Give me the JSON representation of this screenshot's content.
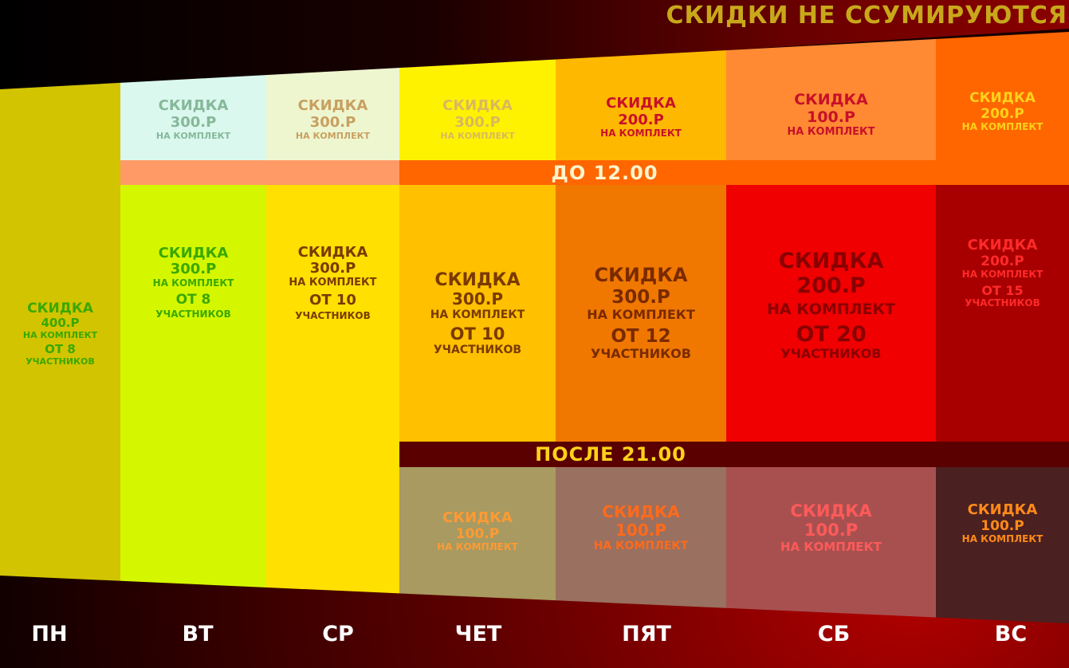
{
  "title": {
    "text": "СКИДКИ НЕ ССУМИРУЮТСЯ",
    "color": "#c8a81a"
  },
  "bands": {
    "morning": {
      "label": "ДО 12.00",
      "color": "#fff4cc",
      "bg_left": "#ff9a66",
      "bg_right": "#ff6600"
    },
    "evening": {
      "label": "ПОСЛЕ 21.00",
      "color": "#ffd21a",
      "bg": "#5a0000"
    }
  },
  "monday": {
    "title": "СКИДКА",
    "amount": "400.Р",
    "unit": "НА КОМПЛЕКТ",
    "from": "ОТ 8",
    "participants": "УЧАСТНИКОВ",
    "bg": "#d2c400",
    "color": "#3aa800"
  },
  "morning": [
    {
      "day": "ВТ",
      "title": "СКИДКА",
      "amount": "300.Р",
      "unit": "НА КОМПЛЕКТ",
      "bg": "#daf8ee",
      "color": "#86b89a"
    },
    {
      "day": "СР",
      "title": "СКИДКА",
      "amount": "300.Р",
      "unit": "НА КОМПЛЕКТ",
      "bg": "#eef6d0",
      "color": "#c8a060"
    },
    {
      "day": "ЧЕТ",
      "title": "СКИДКА",
      "amount": "300.Р",
      "unit": "НА КОМПЛЕКТ",
      "bg": "#fff200",
      "color": "#d8b860"
    },
    {
      "day": "ПЯТ",
      "title": "СКИДКА",
      "amount": "200.Р",
      "unit": "НА КОМПЛЕКТ",
      "bg": "#ffb800",
      "color": "#c8102a"
    },
    {
      "day": "СБ",
      "title": "СКИДКА",
      "amount": "100.Р",
      "unit": "НА КОМПЛЕКТ",
      "bg": "#ff8a33",
      "color": "#c8102a"
    },
    {
      "day": "ВС",
      "title": "СКИДКА",
      "amount": "200.Р",
      "unit": "НА КОМПЛЕКТ",
      "bg": "#ff6600",
      "color": "#ffd21a"
    }
  ],
  "group": [
    {
      "day": "ВТ",
      "title": "СКИДКА",
      "amount": "300.Р",
      "unit": "НА КОМПЛЕКТ",
      "from": "ОТ 8",
      "participants": "УЧАСТНИКОВ",
      "bg": "#d4f700",
      "color": "#3aa800"
    },
    {
      "day": "СР",
      "title": "СКИДКА",
      "amount": "300.Р",
      "unit": "НА КОМПЛЕКТ",
      "from": "ОТ 10",
      "participants": "УЧАСТНИКОВ",
      "bg": "#ffe000",
      "color": "#7a3a00"
    },
    {
      "day": "ЧЕТ",
      "title": "СКИДКА",
      "amount": "300.Р",
      "unit": "НА КОМПЛЕКТ",
      "from": "ОТ 10",
      "participants": "УЧАСТНИКОВ",
      "bg": "#ffc000",
      "color": "#7a3a00"
    },
    {
      "day": "ПЯТ",
      "title": "СКИДКА",
      "amount": "300.Р",
      "unit": "НА КОМПЛЕКТ",
      "from": "ОТ 12",
      "participants": "УЧАСТНИКОВ",
      "bg": "#f07800",
      "color": "#7a2a00"
    },
    {
      "day": "СБ",
      "title": "СКИДКА",
      "amount": "200.Р",
      "unit": "НА КОМПЛЕКТ",
      "from": "ОТ 20",
      "participants": "УЧАСТНИКОВ",
      "bg": "#f00000",
      "color": "#8a0000"
    },
    {
      "day": "ВС",
      "title": "СКИДКА",
      "amount": "200.Р",
      "unit": "НА КОМПЛЕКТ",
      "from": "ОТ 15",
      "participants": "УЧАСТНИКОВ",
      "bg": "#a80000",
      "color": "#ff2a2a"
    }
  ],
  "evening": [
    {
      "day": "ЧЕТ",
      "title": "СКИДКА",
      "amount": "100.Р",
      "unit": "НА КОМПЛЕКТ",
      "bg": "#a89a60",
      "color": "#ff9a33"
    },
    {
      "day": "ПЯТ",
      "title": "СКИДКА",
      "amount": "100.Р",
      "unit": "НА КОМПЛЕКТ",
      "bg": "#9a7060",
      "color": "#ff6a1a"
    },
    {
      "day": "СБ",
      "title": "СКИДКА",
      "amount": "100.Р",
      "unit": "НА КОМПЛЕКТ",
      "bg": "#a85050",
      "color": "#ff5a5a"
    },
    {
      "day": "ВС",
      "title": "СКИДКА",
      "amount": "100.Р",
      "unit": "НА КОМПЛЕКТ",
      "bg": "#4a2020",
      "color": "#ff8a1a"
    }
  ],
  "days": [
    "ПН",
    "ВТ",
    "СР",
    "ЧЕТ",
    "ПЯТ",
    "СБ",
    "ВС"
  ]
}
